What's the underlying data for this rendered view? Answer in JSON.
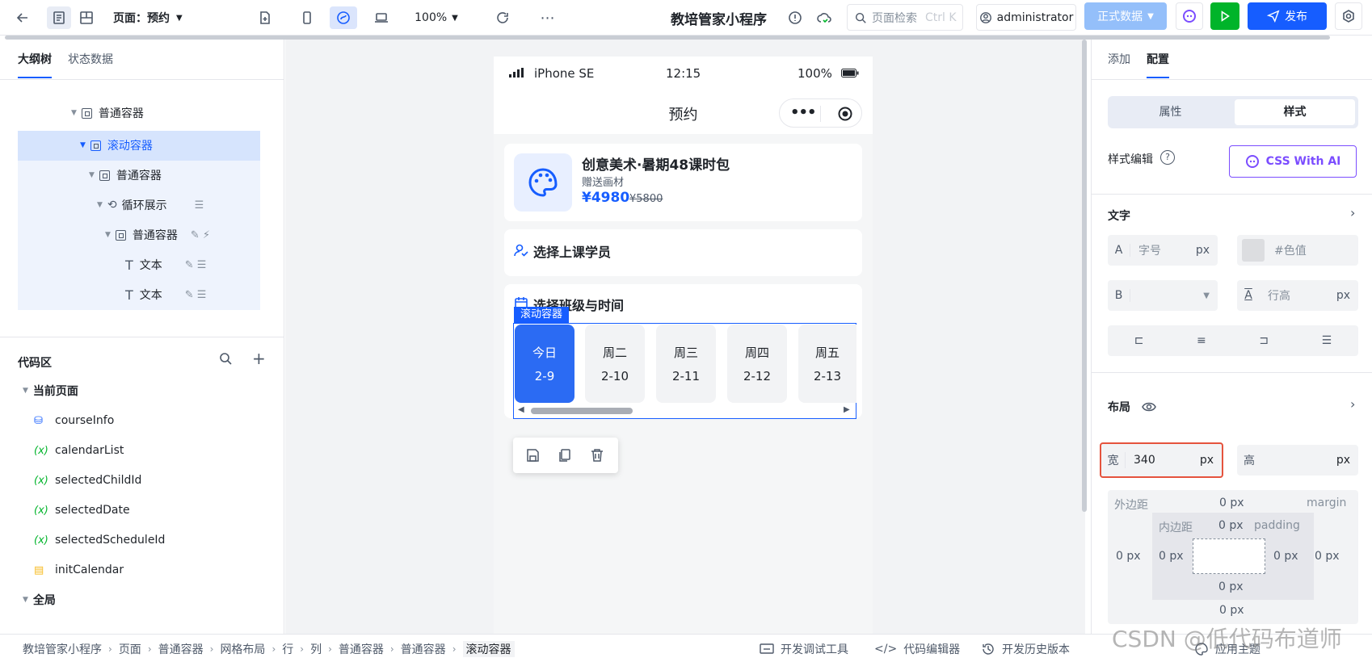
{
  "topbar": {
    "page_label": "页面：预约",
    "zoom": "100%",
    "app_name": "教培管家小程序",
    "search_placeholder": "页面检索",
    "search_shortcut": "Ctrl K",
    "user": "administrator",
    "env_label": "正式数据",
    "publish_label": "发布"
  },
  "left": {
    "tabs": [
      "大纲树",
      "状态数据"
    ],
    "tree": [
      {
        "label": "普通容器"
      },
      {
        "label": "滚动容器"
      },
      {
        "label": "普通容器"
      },
      {
        "label": "循环展示"
      },
      {
        "label": "普通容器"
      },
      {
        "label": "文本"
      },
      {
        "label": "文本"
      }
    ],
    "code_title": "代码区",
    "current_page": "当前页面",
    "code_items": [
      "courseInfo",
      "calendarList",
      "selectedChildId",
      "selectedDate",
      "selectedScheduleId",
      "initCalendar"
    ],
    "global": "全局"
  },
  "phone": {
    "device": "iPhone SE",
    "time": "12:15",
    "battery": "100%",
    "title": "预约",
    "course_name": "创意美术·暑期48课时包",
    "course_gift": "赠送画材",
    "price": "¥4980",
    "original_price": "¥5800",
    "student_title": "选择上课学员",
    "class_title": "选择班级与时间",
    "scroll_tag": "滚动容器",
    "days": [
      {
        "name": "今日",
        "date": "2-9"
      },
      {
        "name": "周二",
        "date": "2-10"
      },
      {
        "name": "周三",
        "date": "2-11"
      },
      {
        "name": "周四",
        "date": "2-12"
      },
      {
        "name": "周五",
        "date": "2-13"
      }
    ]
  },
  "right": {
    "tabs": [
      "添加",
      "配置"
    ],
    "seg": [
      "属性",
      "样式"
    ],
    "style_edit": "样式编辑",
    "css_ai": "CSS With AI",
    "text_section": "文字",
    "font_size_placeholder": "字号",
    "color_placeholder": "#色值",
    "line_height_placeholder": "行高",
    "layout_section": "布局",
    "width_label": "宽",
    "width_value": "340",
    "height_label": "高",
    "unit": "px",
    "margin_label": "外边距",
    "margin_en": "margin",
    "padding_label": "内边距",
    "padding_en": "padding",
    "zero_px": "0 px"
  },
  "bottom": {
    "breadcrumbs": [
      "教培管家小程序",
      "页面",
      "普通容器",
      "网格布局",
      "行",
      "列",
      "普通容器",
      "普通容器",
      "滚动容器"
    ],
    "debug": "开发调试工具",
    "code_editor": "代码编辑器",
    "history": "开发历史版本",
    "theme": "应用主题",
    "watermark": "CSDN @低代码布道师"
  },
  "colors": {
    "primary": "#165dff",
    "green": "#00b42a",
    "highlight": "#d6e4fd",
    "danger": "#e53e3e"
  }
}
